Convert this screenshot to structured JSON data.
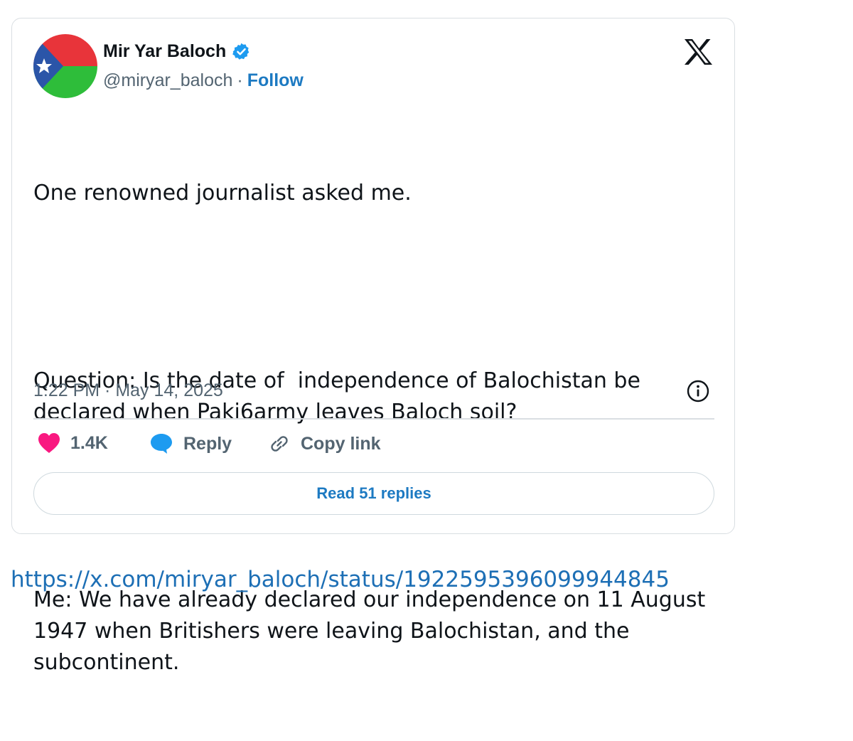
{
  "tweet": {
    "author": {
      "name": "Mir Yar Baloch",
      "handle": "@miryar_baloch",
      "separator": "·",
      "follow_label": "Follow",
      "verified_icon": "verified-badge-icon",
      "avatar_colors": [
        "#e8343a",
        "#2ebd3a",
        "#2b55a8"
      ]
    },
    "platform_icon": "x-logo-icon",
    "paragraphs": [
      "One renowned journalist asked me.",
      "Question: Is the date of  independence of Balochistan be declared when Paki6army leaves Baloch soil?",
      "Me: We have already declared our independence on 11 August 1947 when Britishers were leaving Balochistan, and the subcontinent."
    ],
    "timestamp": "1:22 PM · May 14, 2025",
    "info_icon": "info-icon",
    "actions": {
      "like_count": "1.4K",
      "like_icon": "heart-icon",
      "reply_label": "Reply",
      "reply_icon": "speech-bubble-icon",
      "copy_label": "Copy link",
      "copy_icon": "link-icon"
    },
    "read_replies_label": "Read 51 replies"
  },
  "source_url": "https://x.com/miryar_baloch/status/1922595396099944845",
  "colors": {
    "accent": "#1d7ac2",
    "heart": "#f91880",
    "reply_bubble": "#1d9bf0",
    "muted_text": "#536471",
    "border": "#d9dee2"
  }
}
